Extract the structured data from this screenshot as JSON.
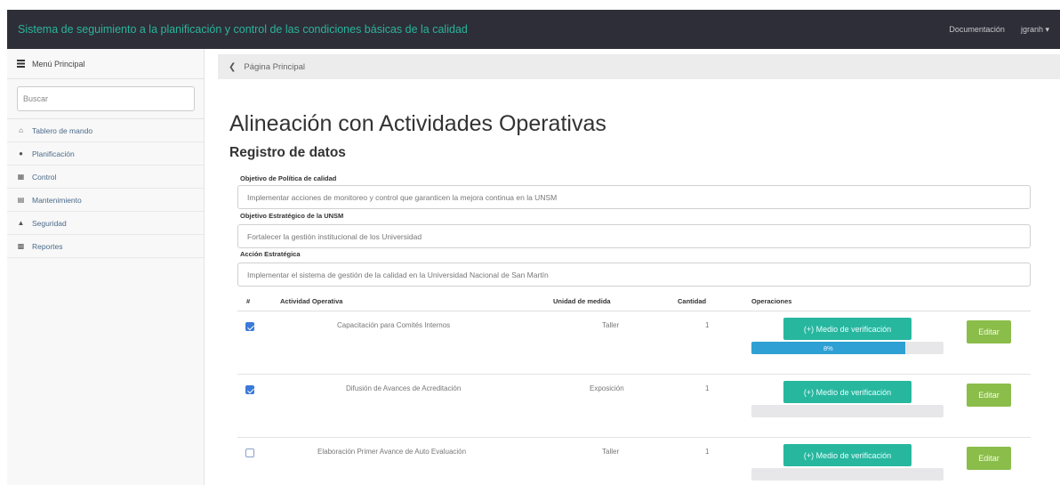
{
  "navbar": {
    "title": "Sistema de seguimiento a la planificación y control de las condiciones básicas de la calidad",
    "links": [
      "Documentación",
      "jgranh ▾"
    ]
  },
  "sidebar": {
    "header": "Menú Principal",
    "search_placeholder": "Buscar",
    "items": [
      {
        "label": "Tablero de mando",
        "icon": "home-icon"
      },
      {
        "label": "Planificación",
        "icon": "circle-icon"
      },
      {
        "label": "Control",
        "icon": "grid-icon"
      },
      {
        "label": "Mantenimiento",
        "icon": "calendar-icon"
      },
      {
        "label": "Seguridad",
        "icon": "user-icon"
      },
      {
        "label": "Reportes",
        "icon": "chart-icon"
      }
    ]
  },
  "breadcrumb": "Página Principal",
  "main": {
    "title": "Alineación con Actividades Operativas",
    "subtitle": "Registro de datos",
    "fields": [
      {
        "label": "Objetivo de Política de calidad",
        "value": "Implementar acciones de monitoreo y control que garanticen la mejora continua en la UNSM"
      },
      {
        "label": "Objetivo Estratégico de la UNSM",
        "value": "Fortalecer la gestión institucional de los Universidad"
      },
      {
        "label": "Acción Estratégica",
        "value": "Implementar el sistema de gestión de la calidad en la Universidad Nacional de San Martín"
      }
    ],
    "table": {
      "headers": [
        "#",
        "Actividad Operativa",
        "Unidad de medida",
        "Cantidad",
        "Operaciones"
      ],
      "rows": [
        {
          "checked": true,
          "activity": "Capacitación para Comités Internos",
          "unit": "Taller",
          "qty": "1",
          "verify_label": "(+) Medio de verificación",
          "progress": 0.8,
          "progress_label": "8%",
          "edit_label": "Editar"
        },
        {
          "checked": true,
          "activity": "Difusión de Avances de Acreditación",
          "unit": "Exposición",
          "qty": "1",
          "verify_label": "(+) Medio de verificación",
          "progress": 0,
          "progress_label": "",
          "edit_label": "Editar"
        },
        {
          "checked": false,
          "activity": "Elaboración Primer Avance de Auto Evaluación",
          "unit": "Taller",
          "qty": "1",
          "verify_label": "(+) Medio de verificación",
          "progress": 0,
          "progress_label": "",
          "edit_label": "Editar"
        }
      ]
    }
  },
  "colors": {
    "navbar": "#2e2e38",
    "brand": "#2bb39b",
    "verify_button": "#27b79f",
    "edit_button": "#8bbd4a",
    "progress": "#2ea0d3"
  }
}
